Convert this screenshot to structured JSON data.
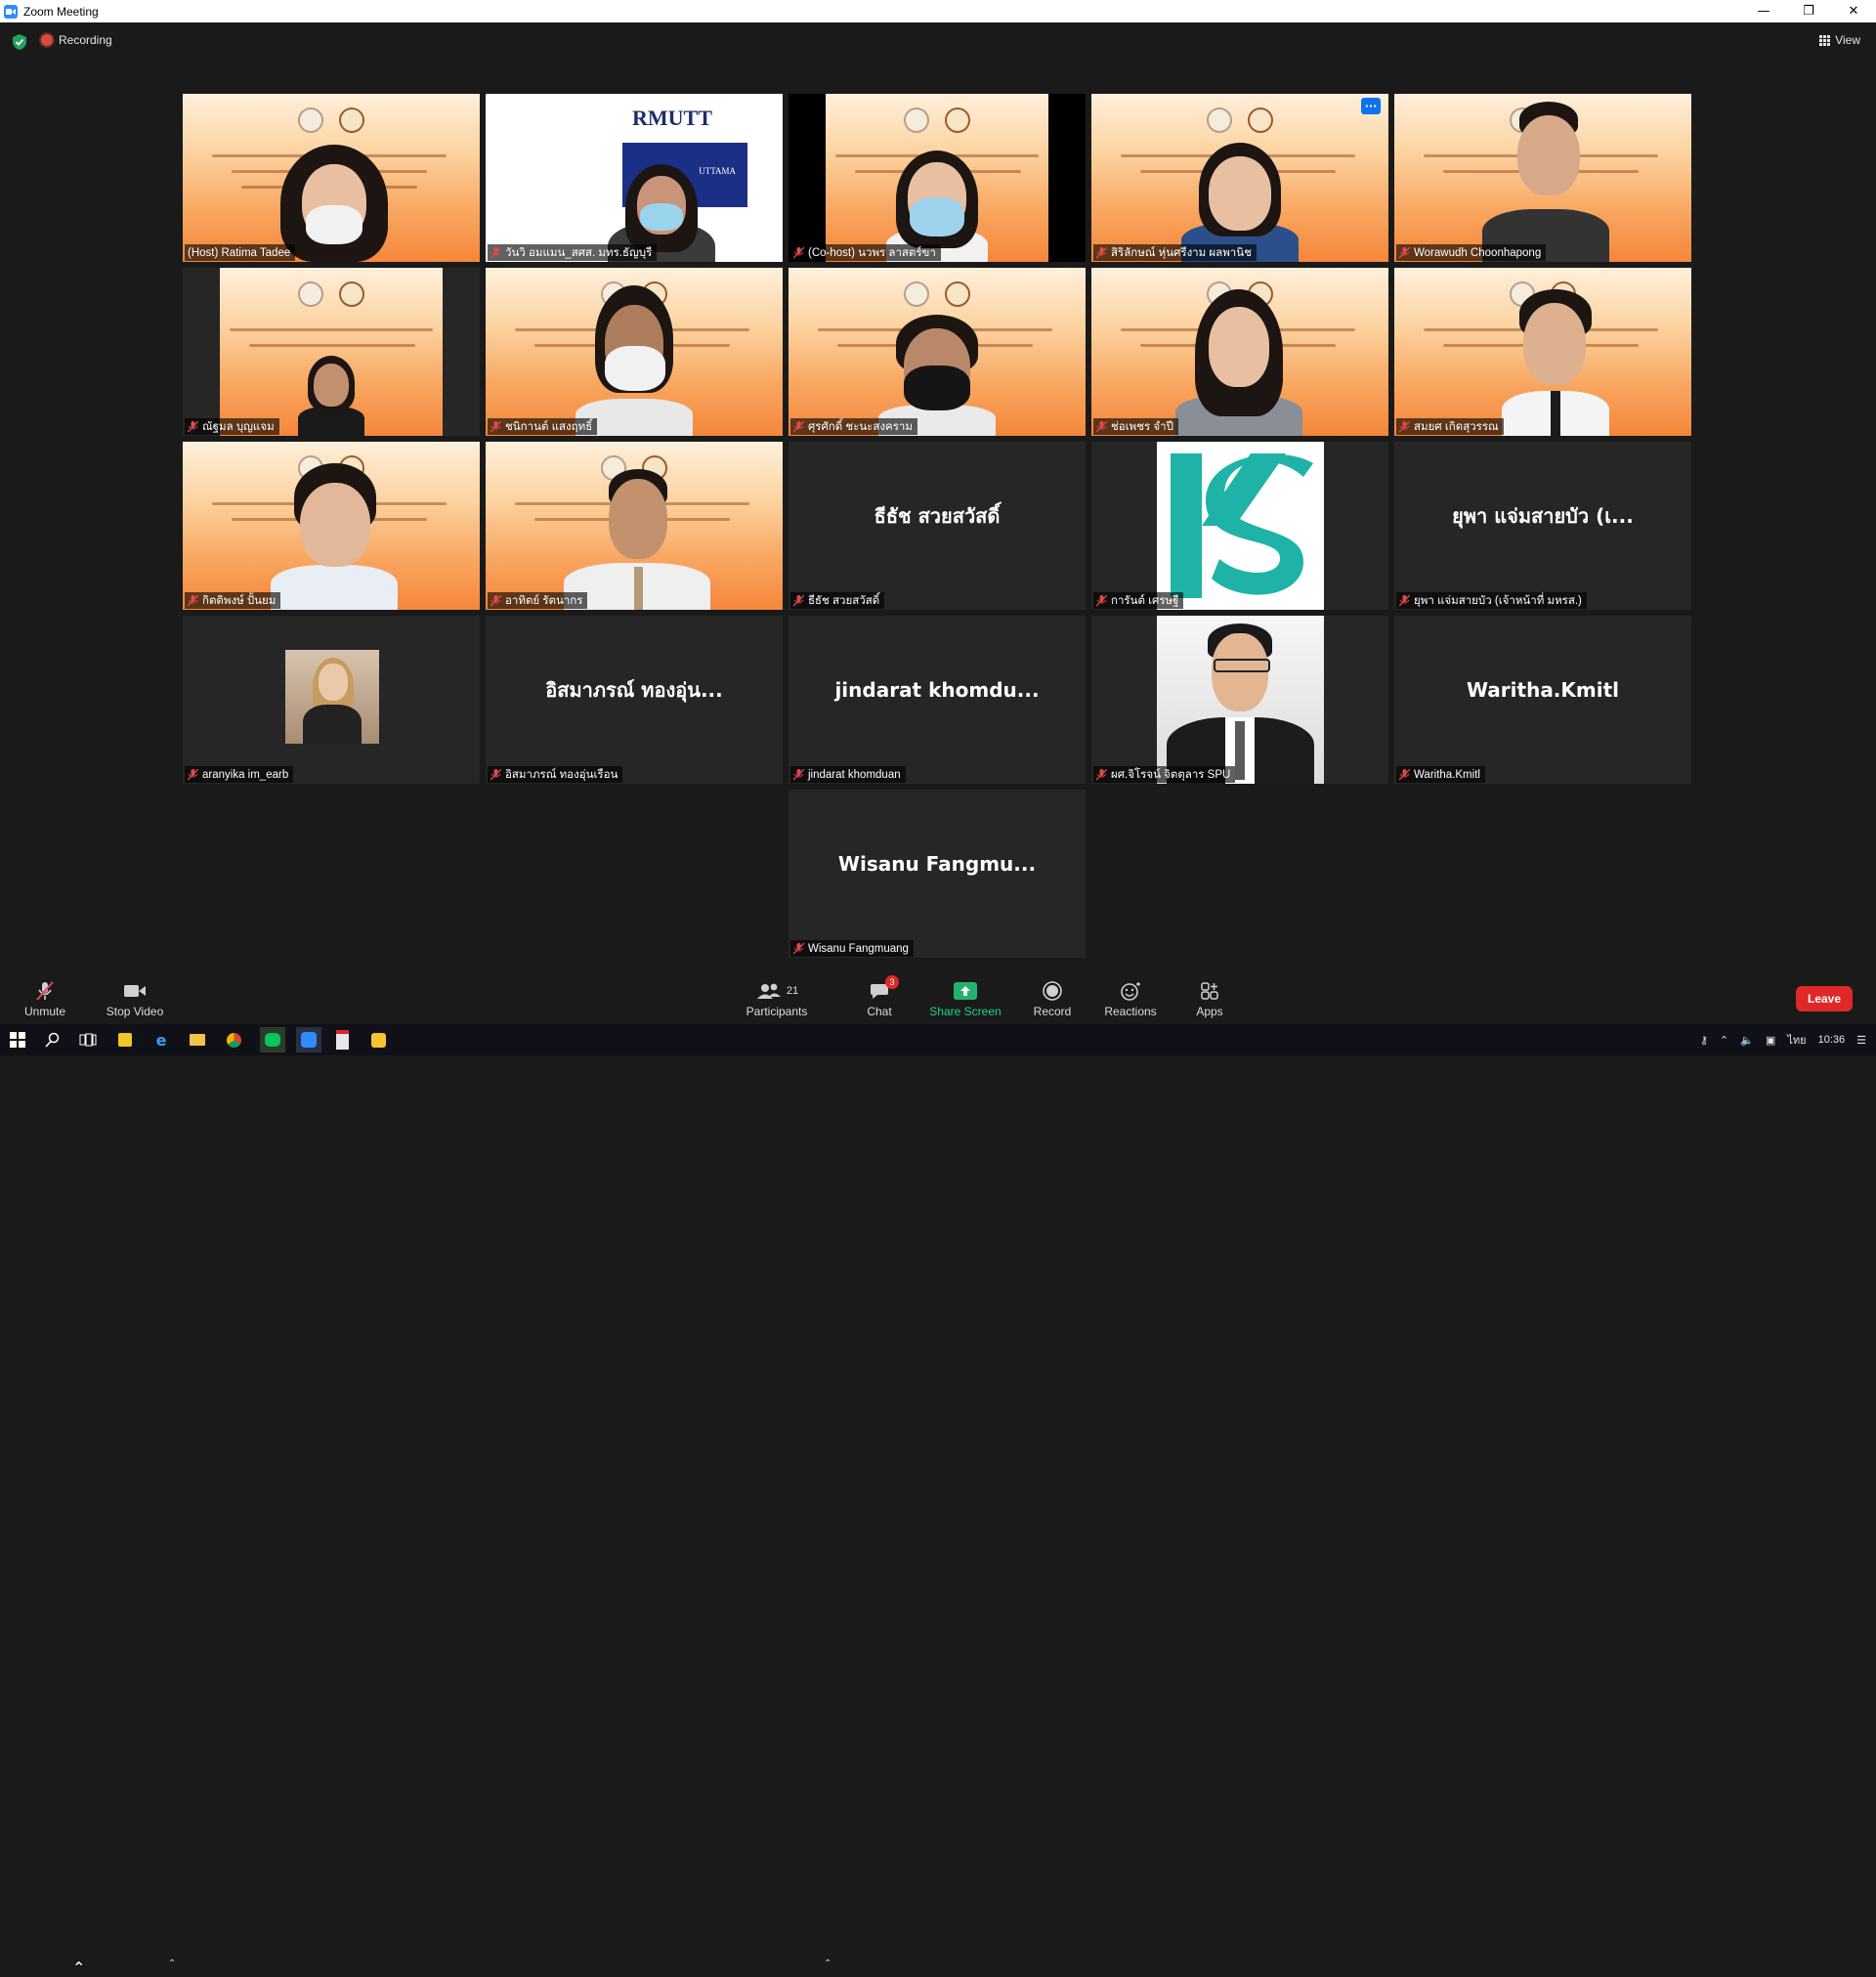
{
  "window": {
    "title": "Zoom Meeting"
  },
  "top": {
    "recording_label": "Recording",
    "view_label": "View"
  },
  "tiles": [
    {
      "name": "(Host) Ratima Tadee"
    },
    {
      "name": "วันวิ  อมแมน_สศส. มทร.ธัญบุรี",
      "logo_text": "RMUTT",
      "banner_text": "UTTAMA"
    },
    {
      "name": "(Co-host) นวพร ลาสตร์ขา"
    },
    {
      "name": "สิริลักษณ์ หุ่นศรีงาม ผลพานิช"
    },
    {
      "name": "Worawudh Choonhapong"
    },
    {
      "name": "ณัฐมล บุญแจม"
    },
    {
      "name": "ชนิกานต์ แสงฤทธิ์"
    },
    {
      "name": "ศุรศักดิ์ ชะนะสงคราม"
    },
    {
      "name": "ช่อเพชร จำปี"
    },
    {
      "name": "สมยศ เกิดสุวรรณ"
    },
    {
      "name": "กิตติพงษ์ ปั้นยม"
    },
    {
      "name": "อาทิตย์ รัตนากร"
    },
    {
      "name": "ธีธัช สวยสวัสดิ์",
      "display": "ธีธัช สวยสวัสดิ์"
    },
    {
      "name": "การันต์ เศรษฐี"
    },
    {
      "name": "ยุพา แจ่มสายบัว (เจ้าหน้าที่ มหรส.)",
      "display": "ยุพา แจ่มสายบัว (เ..."
    },
    {
      "name": "aranyika im_earb"
    },
    {
      "name": "อิสมาภรณ์ ทองอุ่นเรือน",
      "display": "อิสมาภรณ์ ทองอุ่น..."
    },
    {
      "name": "jindarat khomduan",
      "display": "jindarat  khomdu..."
    },
    {
      "name": "ผศ.จิโรจน์ จิตตุลาร SPU"
    },
    {
      "name": "Waritha.Kmitl",
      "display": "Waritha.Kmitl"
    },
    {
      "name": "Wisanu Fangmuang",
      "display": "Wisanu  Fangmu..."
    }
  ],
  "toolbar": {
    "unmute": "Unmute",
    "stop_video": "Stop Video",
    "participants": "Participants",
    "participants_count": "21",
    "chat": "Chat",
    "chat_badge": "3",
    "share_screen": "Share Screen",
    "record": "Record",
    "reactions": "Reactions",
    "apps": "Apps",
    "leave": "Leave"
  },
  "taskbar": {
    "lang": "ไทย",
    "time": "10:36"
  },
  "colors": {
    "active_border": "#e6e374",
    "leave": "#e02828",
    "share": "#23d18b",
    "zoom_blue": "#2d8cff"
  }
}
